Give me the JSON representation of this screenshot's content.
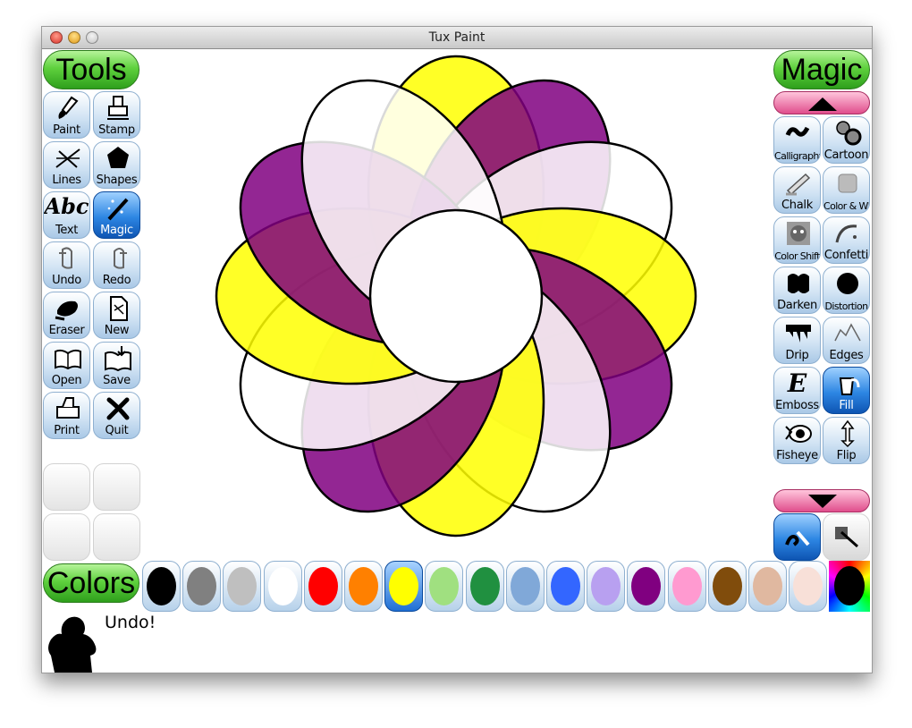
{
  "window": {
    "title": "Tux Paint"
  },
  "tools": {
    "header": "Tools",
    "items": [
      {
        "label": "Paint",
        "icon": "paintbrush-icon"
      },
      {
        "label": "Stamp",
        "icon": "stamp-icon"
      },
      {
        "label": "Lines",
        "icon": "lines-icon"
      },
      {
        "label": "Shapes",
        "icon": "pentagon-icon"
      },
      {
        "label": "Text",
        "icon": "text-abc-icon",
        "glyph": "Abc"
      },
      {
        "label": "Magic",
        "icon": "magic-wand-icon",
        "selected": true
      },
      {
        "label": "Undo",
        "icon": "undo-hand-icon"
      },
      {
        "label": "Redo",
        "icon": "redo-hand-icon"
      },
      {
        "label": "Eraser",
        "icon": "eraser-icon"
      },
      {
        "label": "New",
        "icon": "new-page-icon"
      },
      {
        "label": "Open",
        "icon": "open-book-icon"
      },
      {
        "label": "Save",
        "icon": "save-book-icon"
      },
      {
        "label": "Print",
        "icon": "printer-icon"
      },
      {
        "label": "Quit",
        "icon": "quit-x-icon"
      }
    ]
  },
  "magic": {
    "header": "Magic",
    "items": [
      {
        "label": "Calligraphy",
        "icon": "calligraphy-icon"
      },
      {
        "label": "Cartoon",
        "icon": "cartoon-icon"
      },
      {
        "label": "Chalk",
        "icon": "chalk-icon"
      },
      {
        "label": "Color & White",
        "icon": "color-white-icon"
      },
      {
        "label": "Color Shift",
        "icon": "color-shift-icon"
      },
      {
        "label": "Confetti",
        "icon": "confetti-icon"
      },
      {
        "label": "Darken",
        "icon": "darken-icon"
      },
      {
        "label": "Distortion",
        "icon": "distortion-icon"
      },
      {
        "label": "Drip",
        "icon": "drip-icon"
      },
      {
        "label": "Edges",
        "icon": "edges-icon"
      },
      {
        "label": "Emboss",
        "icon": "emboss-icon",
        "glyph": "E"
      },
      {
        "label": "Fill",
        "icon": "fill-bucket-icon",
        "selected": true
      },
      {
        "label": "Fisheye",
        "icon": "fisheye-icon"
      },
      {
        "label": "Flip",
        "icon": "flip-arrow-icon"
      }
    ],
    "mode_buttons": [
      {
        "icon": "paint-mode-icon",
        "selected": true
      },
      {
        "icon": "fullscreen-mode-icon",
        "selected": false
      }
    ]
  },
  "colors": {
    "header": "Colors",
    "palette": [
      "#000000",
      "#808080",
      "#bfbfbf",
      "#ffffff",
      "#ff0000",
      "#ff8000",
      "#ffff00",
      "#a0e080",
      "#209040",
      "#80a8d8",
      "#3366ff",
      "#b8a0f0",
      "#800080",
      "#ff9ad0",
      "#804c0c",
      "#e0b8a0",
      "#f8e0d8"
    ],
    "selected_index": 6,
    "custom_color": "#000000"
  },
  "status": {
    "message": "Undo!"
  },
  "canvas": {
    "description_colors": {
      "yellow": "#ffff00",
      "purple": "#800080",
      "white": "#ffffff"
    }
  }
}
